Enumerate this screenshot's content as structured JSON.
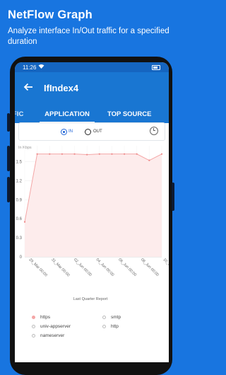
{
  "promo": {
    "title": "NetFlow Graph",
    "subtitle": "Analyze interface In/Out traffic for a specified duration"
  },
  "status_bar": {
    "time": "11:26"
  },
  "app_bar": {
    "title": "IfIndex4",
    "back_icon": "arrow-back-icon"
  },
  "tabs": [
    "FIC",
    "APPLICATION",
    "TOP SOURCE"
  ],
  "active_tab": "APPLICATION",
  "direction": {
    "options": [
      "IN",
      "OUT"
    ],
    "selected": "IN"
  },
  "colors": {
    "brand": "#1875e0",
    "appbar": "#1976d2",
    "series": "#f4a6a6",
    "series_fill": "#fdecec"
  },
  "chart_data": {
    "type": "area",
    "ylabel": "In Kbps",
    "xlabel": "Last Quarter Report",
    "yticks": [
      "1.5",
      "1.2",
      "0.9",
      "0.6",
      "0.3",
      "0"
    ],
    "ylim": [
      0,
      1.75
    ],
    "xticks": [
      "29_Mar 00:00",
      "31_Mar 00:00",
      "02_Jun 00:00",
      "04_Jun 00:00",
      "06_Jun 00:00",
      "08_Jun 00:00",
      "10_Jun 00:00"
    ],
    "series": [
      {
        "name": "https",
        "values": [
          0.55,
          1.62,
          1.62,
          1.62,
          1.62,
          1.61,
          1.62,
          1.62,
          1.62,
          1.62,
          1.52,
          1.62
        ]
      }
    ],
    "grid": true
  },
  "legend": {
    "items": [
      {
        "label": "https",
        "color": "#f4a6a6",
        "filled": true
      },
      {
        "label": "smtp",
        "color": "#bbbbbb",
        "filled": false
      },
      {
        "label": "univ-appserver",
        "color": "#bbbbbb",
        "filled": false
      },
      {
        "label": "http",
        "color": "#bbbbbb",
        "filled": false
      },
      {
        "label": "nameserver",
        "color": "#bbbbbb",
        "filled": false
      }
    ]
  }
}
